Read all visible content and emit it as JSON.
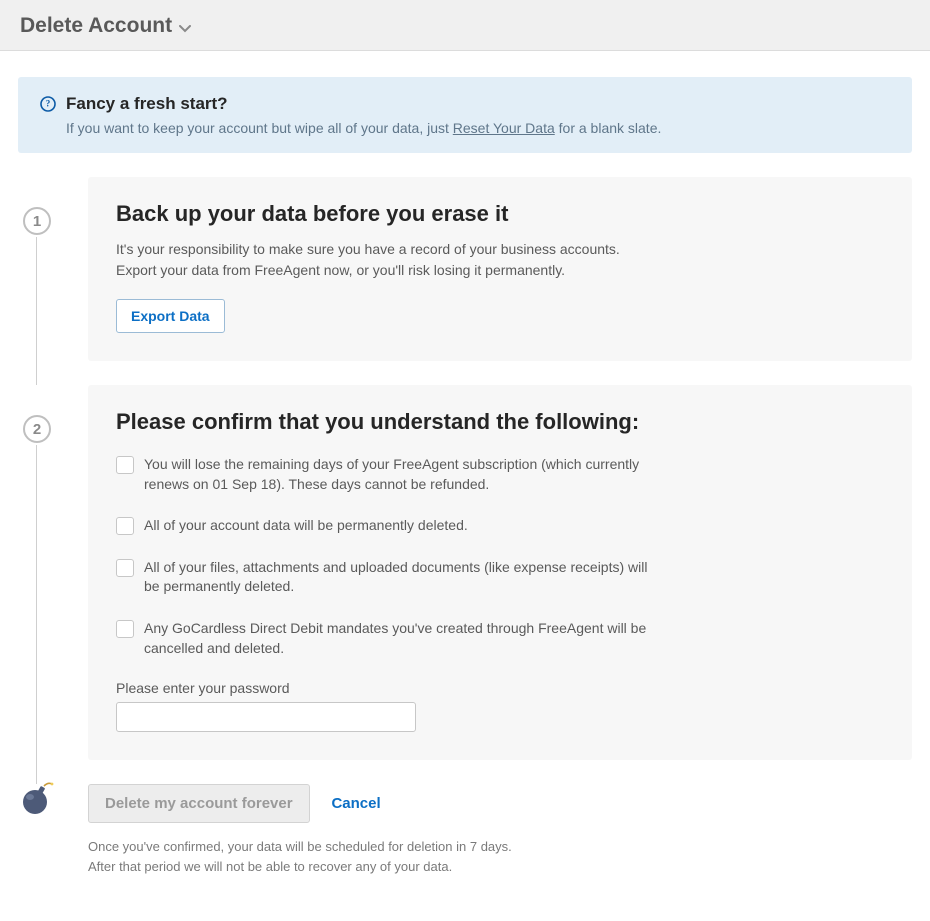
{
  "header": {
    "title": "Delete Account"
  },
  "banner": {
    "title": "Fancy a fresh start?",
    "desc_before": "If you want to keep your account but wipe all of your data, just ",
    "link": "Reset Your Data",
    "desc_after": " for a blank slate."
  },
  "step1": {
    "number": "1",
    "title": "Back up your data before you erase it",
    "desc_line1": "It's your responsibility to make sure you have a record of your business accounts.",
    "desc_line2": "Export your data from FreeAgent now, or you'll risk losing it permanently.",
    "button": "Export Data"
  },
  "step2": {
    "number": "2",
    "title": "Please confirm that you understand the following:",
    "checks": [
      "You will lose the remaining days of your FreeAgent subscription (which currently renews on 01 Sep 18). These days cannot be refunded.",
      "All of your account data will be permanently deleted.",
      "All of your files, attachments and uploaded documents (like expense receipts) will be permanently deleted.",
      "Any GoCardless Direct Debit mandates you've created through FreeAgent will be cancelled and deleted."
    ],
    "password_label": "Please enter your password"
  },
  "actions": {
    "delete": "Delete my account forever",
    "cancel": "Cancel"
  },
  "footer": {
    "line1": "Once you've confirmed, your data will be scheduled for deletion in 7 days.",
    "line2": "After that period we will not be able to recover any of your data."
  }
}
